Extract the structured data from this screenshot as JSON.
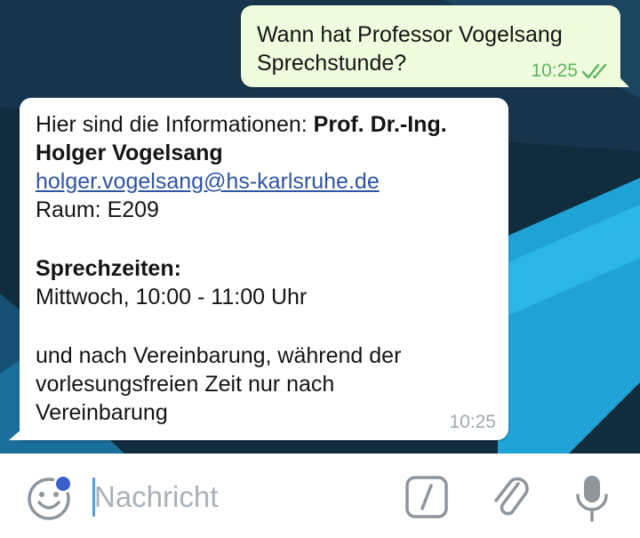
{
  "chat": {
    "outgoing": {
      "line1": "Wann hat Professor Vogelsang",
      "line2": "Sprechstunde?",
      "time": "10:25",
      "status_icon": "double-check-icon"
    },
    "incoming": {
      "intro": "Hier sind die Informationen: ",
      "name_part1": "Prof. Dr.-Ing.",
      "name_part2": "Holger Vogelsang",
      "email": "holger.vogelsang@hs-karlsruhe.de",
      "room": "Raum: E209",
      "hours_heading": "Sprechzeiten:",
      "hours": "Mittwoch, 10:00 - 11:00 Uhr",
      "note_line1": "und nach Vereinbarung, während der",
      "note_line2": "vorlesungsfreien Zeit nur nach",
      "note_line3": "Vereinbarung",
      "time": "10:25"
    }
  },
  "input_bar": {
    "placeholder": "Nachricht",
    "icons": [
      "emoji-icon",
      "command-icon",
      "attach-icon",
      "microphone-icon"
    ]
  },
  "colors": {
    "outgoing_bubble": "#effdde",
    "incoming_bubble": "#ffffff",
    "link": "#2f55a4",
    "read_ticks": "#5fb45f",
    "badge": "#3a5fcd",
    "icon_gray": "#8e969c"
  }
}
